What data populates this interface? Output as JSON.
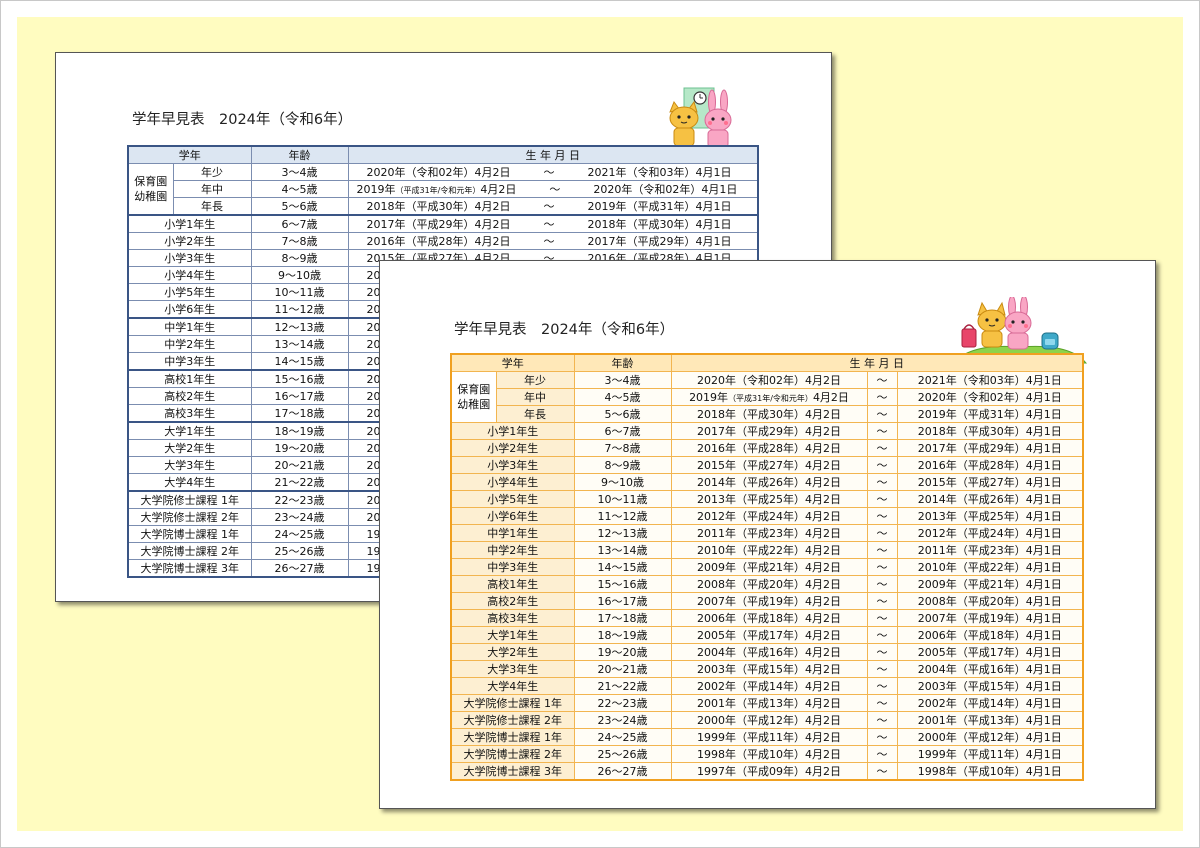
{
  "page_title": "学年早見表　2024年（令和6年）",
  "headers": {
    "grade": "学年",
    "age": "年齢",
    "birthdate": "生 年 月 日"
  },
  "kinder_group": {
    "line1": "保育園",
    "line2": "幼稚園"
  },
  "tilde": "～",
  "rows": [
    {
      "grade": "年少",
      "age": "3～4歳",
      "from": "2020年（令和02年）4月2日",
      "to": "2021年（令和03年）4月1日"
    },
    {
      "grade": "年中",
      "age": "4～5歳",
      "from_main": "2019年",
      "from_small": "（平成31年/令和元年）",
      "from_tail": "4月2日",
      "to": "2020年（令和02年）4月1日"
    },
    {
      "grade": "年長",
      "age": "5～6歳",
      "from": "2018年（平成30年）4月2日",
      "to": "2019年（平成31年）4月1日"
    },
    {
      "grade": "小学1年生",
      "age": "6～7歳",
      "from": "2017年（平成29年）4月2日",
      "to": "2018年（平成30年）4月1日"
    },
    {
      "grade": "小学2年生",
      "age": "7～8歳",
      "from": "2016年（平成28年）4月2日",
      "to": "2017年（平成29年）4月1日"
    },
    {
      "grade": "小学3年生",
      "age": "8～9歳",
      "from": "2015年（平成27年）4月2日",
      "to": "2016年（平成28年）4月1日"
    },
    {
      "grade": "小学4年生",
      "age": "9～10歳",
      "from": "2014年（平成26年）4月2日",
      "to": "2015年（平成27年）4月1日"
    },
    {
      "grade": "小学5年生",
      "age": "10～11歳",
      "from": "2013年（平成25年）4月2日",
      "to": "2014年（平成26年）4月1日"
    },
    {
      "grade": "小学6年生",
      "age": "11～12歳",
      "from": "2012年（平成24年）4月2日",
      "to": "2013年（平成25年）4月1日"
    },
    {
      "grade": "中学1年生",
      "age": "12～13歳",
      "from": "2011年（平成23年）4月2日",
      "to": "2012年（平成24年）4月1日"
    },
    {
      "grade": "中学2年生",
      "age": "13～14歳",
      "from": "2010年（平成22年）4月2日",
      "to": "2011年（平成23年）4月1日"
    },
    {
      "grade": "中学3年生",
      "age": "14～15歳",
      "from": "2009年（平成21年）4月2日",
      "to": "2010年（平成22年）4月1日"
    },
    {
      "grade": "高校1年生",
      "age": "15～16歳",
      "from": "2008年（平成20年）4月2日",
      "to": "2009年（平成21年）4月1日"
    },
    {
      "grade": "高校2年生",
      "age": "16～17歳",
      "from": "2007年（平成19年）4月2日",
      "to": "2008年（平成20年）4月1日"
    },
    {
      "grade": "高校3年生",
      "age": "17～18歳",
      "from": "2006年（平成18年）4月2日",
      "to": "2007年（平成19年）4月1日"
    },
    {
      "grade": "大学1年生",
      "age": "18～19歳",
      "from": "2005年（平成17年）4月2日",
      "to": "2006年（平成18年）4月1日"
    },
    {
      "grade": "大学2年生",
      "age": "19～20歳",
      "from": "2004年（平成16年）4月2日",
      "to": "2005年（平成17年）4月1日"
    },
    {
      "grade": "大学3年生",
      "age": "20～21歳",
      "from": "2003年（平成15年）4月2日",
      "to": "2004年（平成16年）4月1日"
    },
    {
      "grade": "大学4年生",
      "age": "21～22歳",
      "from": "2002年（平成14年）4月2日",
      "to": "2003年（平成15年）4月1日"
    },
    {
      "grade": "大学院修士課程 1年",
      "age": "22～23歳",
      "from": "2001年（平成13年）4月2日",
      "to": "2002年（平成14年）4月1日"
    },
    {
      "grade": "大学院修士課程 2年",
      "age": "23～24歳",
      "from": "2000年（平成12年）4月2日",
      "to": "2001年（平成13年）4月1日"
    },
    {
      "grade": "大学院博士課程 1年",
      "age": "24～25歳",
      "from": "1999年（平成11年）4月2日",
      "to": "2000年（平成12年）4月1日"
    },
    {
      "grade": "大学院博士課程 2年",
      "age": "25～26歳",
      "from": "1998年（平成10年）4月2日",
      "to": "1999年（平成11年）4月1日"
    },
    {
      "grade": "大学院博士課程 3年",
      "age": "26～27歳",
      "from": "1997年（平成09年）4月2日",
      "to": "1998年（平成10年）4月1日"
    }
  ],
  "back_partial": [
    "20",
    "20",
    "20",
    "20",
    "20",
    "20",
    "20",
    "20",
    "20",
    "20",
    "20",
    "20",
    "20",
    "20",
    "20",
    "20",
    "19",
    "19",
    "19",
    "19"
  ],
  "colors": {
    "back_border": "#3a5585",
    "front_border": "#f0a020",
    "background": "#fffcc0"
  },
  "icons": [
    "cat-icon",
    "rabbit-icon",
    "clock-icon",
    "school-bag-icon"
  ]
}
